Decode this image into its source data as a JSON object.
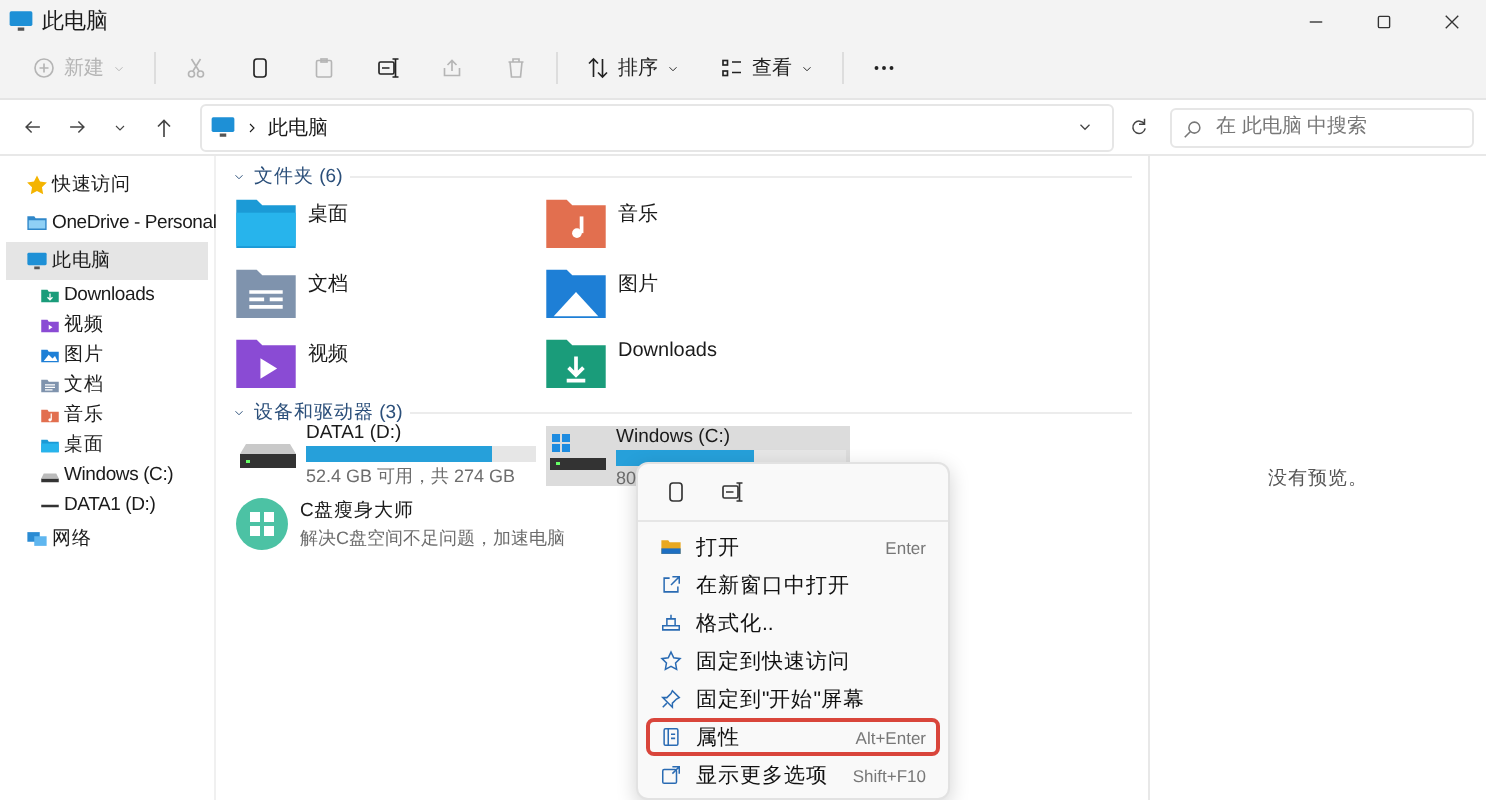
{
  "window": {
    "title": "此电脑"
  },
  "toolbar": {
    "buttons": [
      {
        "kind": "new",
        "label": "新建",
        "disabled": true
      },
      {
        "kind": "cut",
        "disabled": true
      },
      {
        "kind": "copy",
        "disabled": false
      },
      {
        "kind": "paste",
        "disabled": true
      },
      {
        "kind": "rename",
        "disabled": false
      },
      {
        "kind": "share",
        "disabled": true
      },
      {
        "kind": "delete",
        "disabled": true
      },
      {
        "kind": "sort",
        "label": "排序",
        "disabled": false
      },
      {
        "kind": "view",
        "label": "查看",
        "disabled": false
      },
      {
        "kind": "more",
        "disabled": false
      }
    ]
  },
  "address": {
    "path": "此电脑",
    "search": {
      "placeholder": "在 此电脑 中搜索"
    }
  },
  "sidebar": {
    "items": [
      {
        "kind": "star",
        "label": "快速访问",
        "selected": false
      },
      {
        "kind": "cloud",
        "label": "OneDrive - Personal",
        "selected": false
      },
      {
        "kind": "pc",
        "label": "此电脑",
        "selected": true,
        "children": [
          {
            "kind": "downloads",
            "label": "Downloads",
            "selected": false
          },
          {
            "kind": "video",
            "label": "视频",
            "selected": false
          },
          {
            "kind": "pictures",
            "label": "图片",
            "selected": false
          },
          {
            "kind": "documents",
            "label": "文档",
            "selected": false
          },
          {
            "kind": "music",
            "label": "音乐",
            "selected": false
          },
          {
            "kind": "desktop",
            "label": "桌面",
            "selected": false
          },
          {
            "kind": "drive-c",
            "label": "Windows (C:)",
            "selected": false
          },
          {
            "kind": "drive-d",
            "label": "DATA1 (D:)",
            "selected": false
          }
        ]
      },
      {
        "kind": "network",
        "label": "网络",
        "selected": false
      }
    ]
  },
  "folders": {
    "header": "文件夹 (6)",
    "items": [
      {
        "kind": "desktop",
        "name": "桌面"
      },
      {
        "kind": "music",
        "name": "音乐"
      },
      {
        "kind": "documents",
        "name": "文档"
      },
      {
        "kind": "pictures",
        "name": "图片"
      },
      {
        "kind": "video",
        "name": "视频"
      },
      {
        "kind": "downloads",
        "name": "Downloads"
      }
    ]
  },
  "drives": {
    "header": "设备和驱动器 (3)",
    "items": [
      {
        "kind": "drive",
        "name": "DATA1 (D:)",
        "level": 0.81,
        "caption": "52.4 GB 可用，共 274 GB",
        "selected": false
      },
      {
        "kind": "system-drive",
        "name": "Windows (C:)",
        "level": 0.6,
        "caption": "80",
        "selected": true
      },
      {
        "kind": "app",
        "name": "C盘瘦身大师",
        "caption": "解决C盘空间不足问题，加速电脑"
      }
    ]
  },
  "context_menu": {
    "quick_actions": [
      {
        "kind": "copy"
      },
      {
        "kind": "rename"
      }
    ],
    "items": [
      {
        "kind": "open",
        "label": "打开",
        "shortcut": "Enter",
        "highlighted": false
      },
      {
        "kind": "new-window",
        "label": "在新窗口中打开",
        "highlighted": false
      },
      {
        "kind": "format",
        "label": "格式化..",
        "highlighted": false
      },
      {
        "kind": "pin-quick",
        "label": "固定到快速访问",
        "highlighted": false
      },
      {
        "kind": "pin-start",
        "label": "固定到\"开始\"屏幕",
        "highlighted": false
      },
      {
        "kind": "properties",
        "label": "属性",
        "shortcut": "Alt+Enter",
        "highlighted": true
      },
      {
        "kind": "more-options",
        "label": "显示更多选项",
        "shortcut": "Shift+F10",
        "highlighted": false
      }
    ]
  },
  "preview": {
    "message": "没有预览。"
  }
}
